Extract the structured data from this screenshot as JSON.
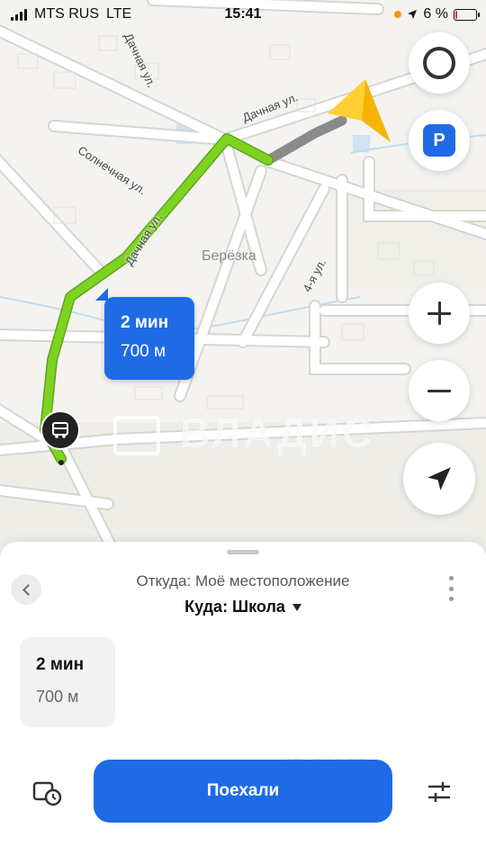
{
  "status_bar": {
    "carrier": "MTS RUS",
    "network": "LTE",
    "time": "15:41",
    "battery_percent": "6 %",
    "battery_level": 0.06
  },
  "map": {
    "streets": {
      "dachnaya_top": "Дачная ул.",
      "dachnaya_left": "Дачная ул.",
      "dachnaya_vertical": "Дачная ул.",
      "solnechnaya": "Солнечная ул.",
      "fourth": "4-я ул."
    },
    "district": "Берёзка",
    "watermark": "ВЛАДИС",
    "route_bubble": {
      "time": "2 мин",
      "distance": "700 м"
    },
    "colors": {
      "route": "#7ed321",
      "route_traffic": "#8a8a8a",
      "accent": "#1f6be6",
      "arrow": "#f5b400"
    }
  },
  "controls": {
    "alice_icon": "alice-icon",
    "parking_label": "P",
    "zoom_in_icon": "plus-icon",
    "zoom_out_icon": "minus-icon",
    "locate_icon": "navigation-arrow-icon"
  },
  "sheet": {
    "from": "Откуда: Моё местоположение",
    "to": "Куда: Школа",
    "route_card": {
      "time": "2 мин",
      "distance": "700 м"
    },
    "go_button": "Поехали",
    "watermark": "ID 31927"
  }
}
